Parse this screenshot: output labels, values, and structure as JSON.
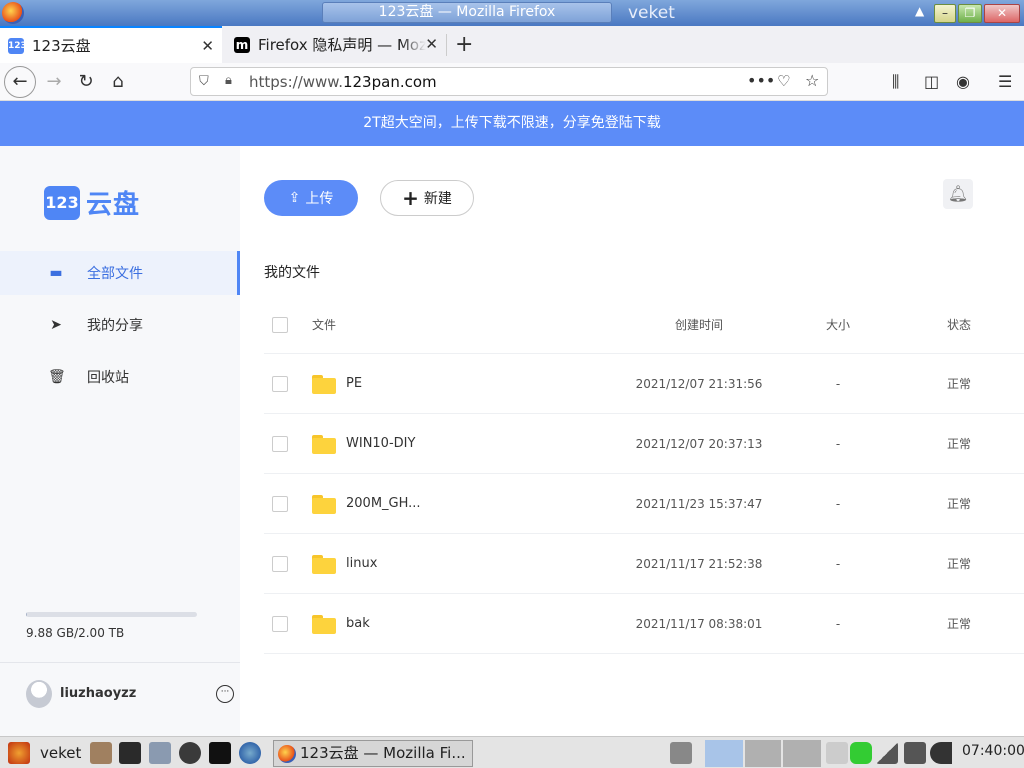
{
  "window": {
    "title": "123云盘 — Mozilla Firefox",
    "host": "veket",
    "minimize": "–",
    "maximize": "❐",
    "close": "✕"
  },
  "tabs": [
    {
      "label": "123云盘",
      "favicon": "123",
      "close": "✕"
    },
    {
      "label": "Firefox 隐私声明 — Mozilla",
      "favicon": "m",
      "close": "✕"
    }
  ],
  "new_tab": "+",
  "nav": {
    "url_prefix": "https://www.",
    "url_domain": "123pan.com",
    "page_actions": "•••"
  },
  "banner": "2T超大空间，上传下载不限速，分享免登陆下载",
  "sidebar": {
    "logo_mark": "123",
    "logo_text": "云盘",
    "items": [
      {
        "label": "全部文件",
        "icon": "folder-icon"
      },
      {
        "label": "我的分享",
        "icon": "send-icon"
      },
      {
        "label": "回收站",
        "icon": "trash-icon"
      }
    ],
    "storage_text": "9.88 GB/2.00 TB",
    "storage_fraction": 0.005,
    "username": "liuzhaoyzz",
    "more": "···"
  },
  "main": {
    "upload_label": "上传",
    "new_label": "新建",
    "section_title": "我的文件",
    "columns": {
      "name": "文件",
      "time": "创建时间",
      "size": "大小",
      "status": "状态"
    },
    "files": [
      {
        "name": "PE",
        "time": "2021/12/07 21:31:56",
        "size": "-",
        "status": "正常"
      },
      {
        "name": "WIN10-DIY",
        "time": "2021/12/07 20:37:13",
        "size": "-",
        "status": "正常"
      },
      {
        "name": "200M_GH...",
        "time": "2021/11/23 15:37:47",
        "size": "-",
        "status": "正常"
      },
      {
        "name": "linux",
        "time": "2021/11/17 21:52:38",
        "size": "-",
        "status": "正常"
      },
      {
        "name": "bak",
        "time": "2021/11/17 08:38:01",
        "size": "-",
        "status": "正常"
      }
    ]
  },
  "taskbar": {
    "start_label": "veket",
    "window_label": "123云盘 — Mozilla Fi...",
    "clock": "07:40:00"
  },
  "colors": {
    "accent": "#5c8cf8",
    "folder": "#fdd33d",
    "sidebar_bg": "#f7f8fa"
  }
}
